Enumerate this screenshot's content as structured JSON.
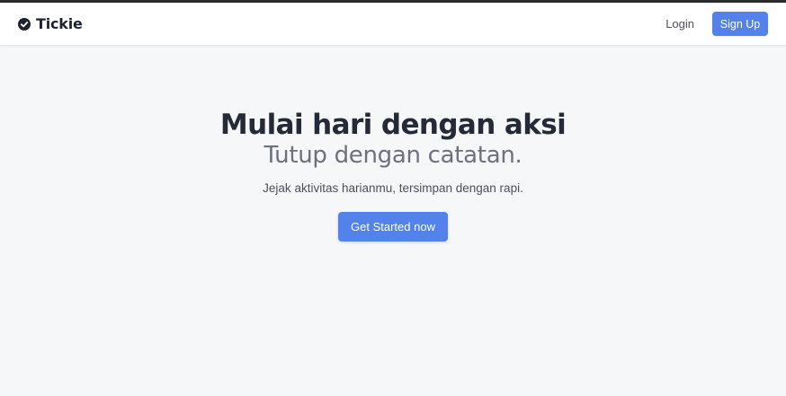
{
  "navbar": {
    "brand_name": "Tickie",
    "brand_icon": "check-circle-icon",
    "login_label": "Login",
    "signup_label": "Sign Up"
  },
  "hero": {
    "title": "Mulai hari dengan aksi",
    "subtitle": "Tutup dengan catatan.",
    "description": "Jejak aktivitas harianmu, tersimpan dengan rapi.",
    "cta_label": "Get Started now"
  },
  "colors": {
    "accent": "#5282ea",
    "background": "#f6f7f9",
    "title": "#252a38",
    "subtitle": "#6c717d"
  }
}
